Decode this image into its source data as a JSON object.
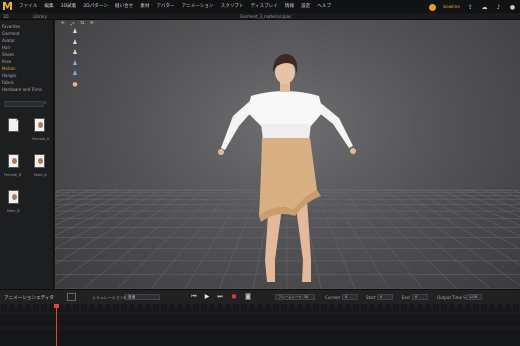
{
  "app": {
    "logo_letter": "M"
  },
  "menu": {
    "items": [
      "ファイル",
      "編集",
      "3D試着",
      "2Dパターン",
      "縫い合せ",
      "素材",
      "アバター",
      "アニメーション",
      "スクリプト",
      "ディスプレイ",
      "情報",
      "設定",
      "ヘルプ"
    ]
  },
  "user": {
    "name": "bowline"
  },
  "subbar": {
    "zoom": "3D",
    "library": "Library",
    "file_title": "Garment_3_material.zpac"
  },
  "sidebar": {
    "categories": [
      {
        "label": "Favorites",
        "active": false
      },
      {
        "label": "Garment",
        "active": false
      },
      {
        "label": "Avatar",
        "active": false
      },
      {
        "label": "Hair",
        "active": false
      },
      {
        "label": "Shoes",
        "active": false
      },
      {
        "label": "Pose",
        "active": false
      },
      {
        "label": "Motion",
        "active": true
      },
      {
        "label": "Hanger",
        "active": false
      },
      {
        "label": "Fabric",
        "active": false
      },
      {
        "label": "Hardware and Trims",
        "active": false
      }
    ],
    "files": [
      {
        "label": ""
      },
      {
        "label": "Female_A"
      },
      {
        "label": "Female_B"
      },
      {
        "label": "Male_A"
      },
      {
        "label": "Male_B"
      }
    ]
  },
  "viewport": {
    "toolbar": [
      "✛",
      "⤢",
      "⇆",
      "⟳"
    ]
  },
  "anim": {
    "title": "アニメーションエディタ",
    "sim_label": "シミュレーション精度",
    "sim_value": "普通",
    "frame_value": "フレームレート: 30",
    "current_label": "Current",
    "current_value": "0",
    "start_label": "Start",
    "start_value": "0",
    "end_label": "End",
    "end_value": "0",
    "time_step_label": "Output Time Step",
    "time_step_value": "1.00"
  },
  "status": {
    "text": ""
  },
  "colors": {
    "accent": "#e79a31",
    "logo": "#f0b429",
    "playhead": "#e0463a",
    "skin": "#e3b99a",
    "skirt": "#d9b082",
    "blouse": "#f4f4f4",
    "hair": "#3b2a22"
  }
}
